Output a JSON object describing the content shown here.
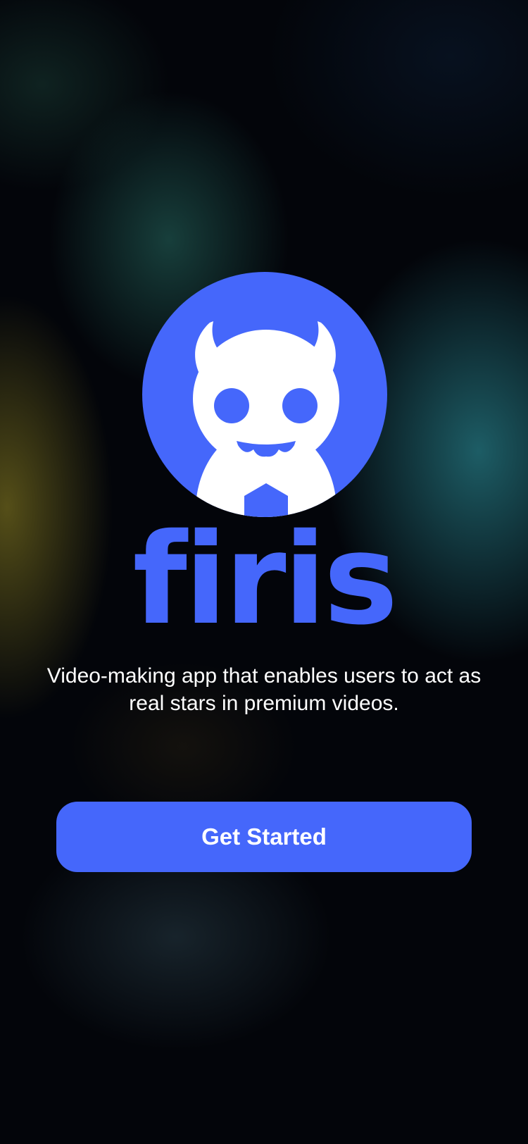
{
  "brand": {
    "name": "firis",
    "logo_icon": "monster-mascot-icon",
    "accent_color": "#4567fb"
  },
  "tagline": "Video-making app that enables users to act as real stars in premium videos.",
  "cta": {
    "label": "Get Started"
  }
}
